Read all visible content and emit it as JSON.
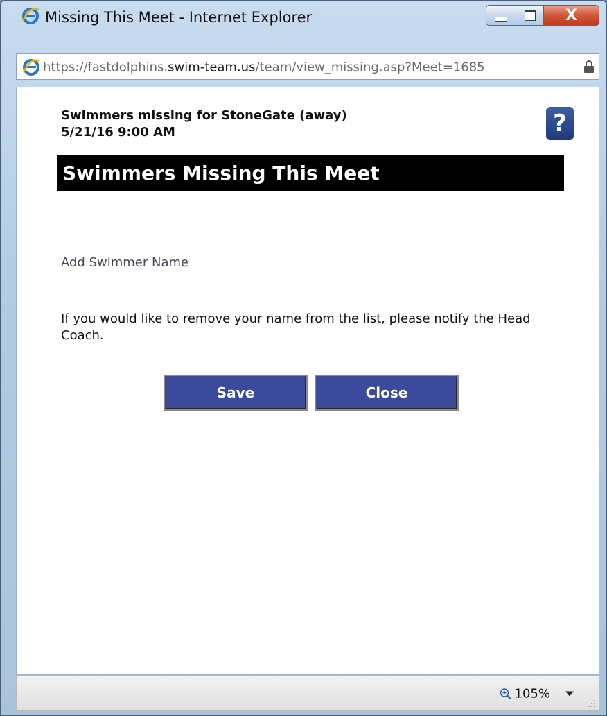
{
  "window": {
    "title": "Missing This Meet - Internet Explorer",
    "close_glyph": "X"
  },
  "address": {
    "url_prefix": "https://",
    "url_host_pre": "fastdolphins.",
    "url_host": "swim-team.us",
    "url_path": "/team/view_missing.asp?Meet=1685"
  },
  "page": {
    "meet_name": "Swimmers missing for StoneGate (away)",
    "meet_date": "5/21/16 9:00 AM",
    "help_glyph": "?",
    "section_title": "Swimmers Missing This Meet",
    "add_swimmer_label": "Add Swimmer Name",
    "notice": "If you would like to remove your name from the list, please notify the Head Coach.",
    "save_label": "Save",
    "close_label": "Close"
  },
  "statusbar": {
    "zoom_level": "105%"
  },
  "colors": {
    "button_bg": "#3b4a9a",
    "header_bg": "#000000",
    "help_icon_bg": "#2b4a8a"
  }
}
